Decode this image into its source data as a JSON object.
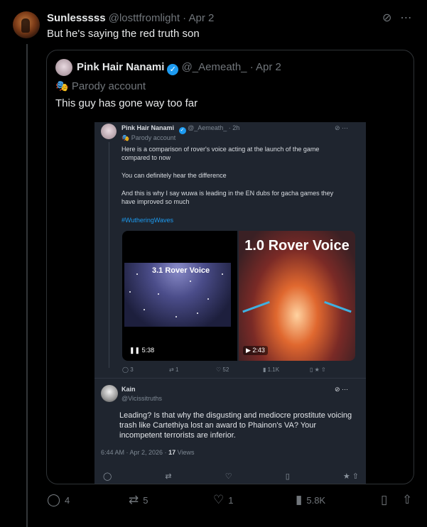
{
  "post": {
    "display_name": "Sunlesssss",
    "handle": "@losttfromlight",
    "date": "· Apr 2",
    "text": "But he's saying the red truth son",
    "menu_icon": "more-icon",
    "grok_icon": "slash-circle-icon"
  },
  "quote": {
    "display_name": "Pink Hair Nanami",
    "handle": "@_Aemeath_",
    "date": "· Apr 2",
    "parody_label": "Parody account",
    "text": "This guy has gone way too far"
  },
  "embedded": {
    "display_name": "Pink Hair Nanami",
    "handle": "@_Aemeath_",
    "time": "· 2h",
    "parody_label": "Parody account",
    "p1": "Here is a comparison of rover's voice acting at the launch of the game compared to now",
    "p2": "You can definitely hear the difference",
    "p3": "And this is why I say wuwa is leading in the EN dubs for gacha games they have improved so much",
    "hashtag": "#WutheringWaves",
    "video1_label": "3.1 Rover Voice",
    "video1_duration": "❚❚ 5:38",
    "video2_label": "1.0 Rover Voice",
    "video2_duration": "▶ 2:43",
    "replies": "3",
    "reposts": "1",
    "likes": "52",
    "views": "1.1K",
    "reply_name": "Kain",
    "reply_handle": "@Vicissitruths",
    "reply_text": "Leading? Is that why the disgusting and mediocre prostitute voicing trash like Cartethiya lost an award to Phainon's VA? Your incompetent terrorists are inferior.",
    "reply_time": "6:44 AM · Apr 2, 2026 ·",
    "reply_views": "17",
    "reply_views_label": "Views"
  },
  "actions": {
    "replies": "4",
    "reposts": "5",
    "likes": "1",
    "views": "5.8K"
  }
}
